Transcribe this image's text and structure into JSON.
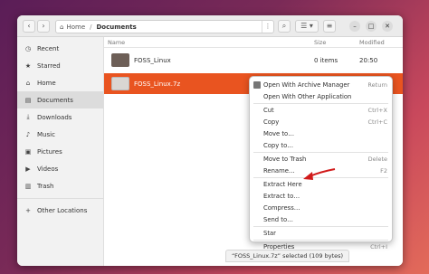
{
  "headerbar": {
    "back_icon": "chevron-left-icon",
    "forward_icon": "chevron-right-icon",
    "path": [
      "Home",
      "Documents"
    ],
    "search_icon": "search-icon",
    "view_icon": "list-view-icon",
    "sort_icon": "chevron-down-icon",
    "controls": [
      "–",
      "□",
      "✕"
    ]
  },
  "sidebar": {
    "items": [
      {
        "label": "Recent",
        "icon": "clock-icon",
        "glyph": "◷"
      },
      {
        "label": "Starred",
        "icon": "star-icon",
        "glyph": "★"
      },
      {
        "label": "Home",
        "icon": "home-icon",
        "glyph": "⌂"
      },
      {
        "label": "Documents",
        "icon": "document-icon",
        "glyph": "▤"
      },
      {
        "label": "Downloads",
        "icon": "download-icon",
        "glyph": "⤓"
      },
      {
        "label": "Music",
        "icon": "music-icon",
        "glyph": "♪"
      },
      {
        "label": "Pictures",
        "icon": "picture-icon",
        "glyph": "▣"
      },
      {
        "label": "Videos",
        "icon": "video-icon",
        "glyph": "▶"
      },
      {
        "label": "Trash",
        "icon": "trash-icon",
        "glyph": "🗑"
      }
    ],
    "other": {
      "label": "Other Locations",
      "glyph": "+"
    }
  },
  "columns": {
    "name": "Name",
    "size": "Size",
    "modified": "Modified"
  },
  "files": [
    {
      "name": "FOSS_Linux",
      "size": "0 items",
      "modified": "20:50"
    },
    {
      "name": "FOSS_Linux.7z",
      "size": "",
      "modified": ""
    }
  ],
  "context_menu": {
    "items": [
      {
        "label": "Open With Archive Manager",
        "accel": "Return"
      },
      {
        "label": "Open With Other Application",
        "accel": ""
      },
      {
        "label": "Cut",
        "accel": "Ctrl+X"
      },
      {
        "label": "Copy",
        "accel": "Ctrl+C"
      },
      {
        "label": "Move to…",
        "accel": ""
      },
      {
        "label": "Copy to…",
        "accel": ""
      },
      {
        "label": "Move to Trash",
        "accel": "Delete"
      },
      {
        "label": "Rename…",
        "accel": "F2"
      },
      {
        "label": "Extract Here",
        "accel": ""
      },
      {
        "label": "Extract to…",
        "accel": ""
      },
      {
        "label": "Compress…",
        "accel": ""
      },
      {
        "label": "Send to…",
        "accel": ""
      },
      {
        "label": "Star",
        "accel": ""
      },
      {
        "label": "Properties",
        "accel": "Ctrl+I"
      }
    ]
  },
  "status": "“FOSS_Linux.7z” selected (109 bytes)",
  "colors": {
    "accent": "#e95420",
    "arrow": "#d11a1a"
  }
}
